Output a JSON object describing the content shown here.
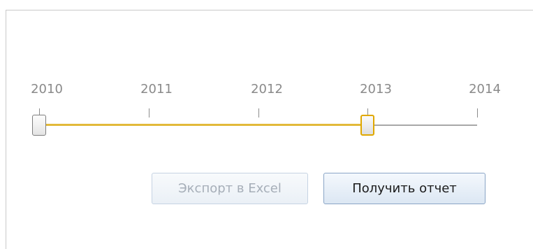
{
  "slider": {
    "years": [
      "2010",
      "2011",
      "2012",
      "2013",
      "2014"
    ],
    "range_start": "2010",
    "range_end": "2013",
    "range_color": "#e2b93a",
    "track_color": "#a8a8a8"
  },
  "buttons": {
    "export_label": "Экспорт в Excel",
    "export_enabled": false,
    "report_label": "Получить отчет",
    "report_enabled": true
  }
}
